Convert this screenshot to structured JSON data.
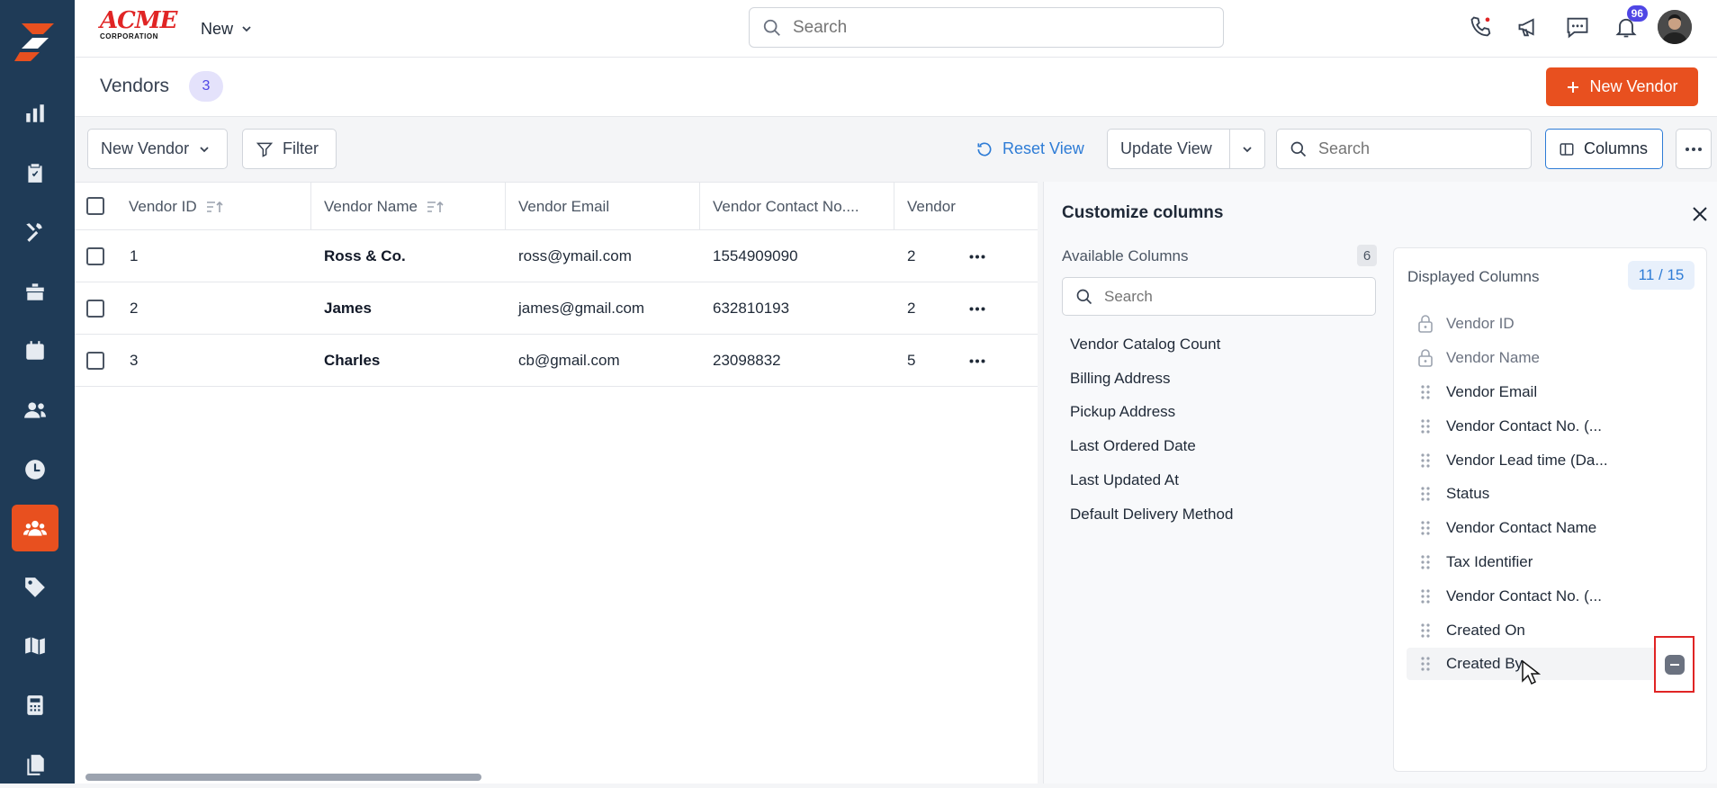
{
  "topbar": {
    "brand_top": "ACME",
    "brand_bottom": "CORPORATION",
    "new_menu_label": "New",
    "search_placeholder": "Search",
    "notification_count": "96"
  },
  "page": {
    "title": "Vendors",
    "count": "3",
    "new_button_label": "New Vendor"
  },
  "toolbar": {
    "view_select_label": "New Vendor",
    "filter_label": "Filter",
    "reset_view_label": "Reset View",
    "update_view_label": "Update View",
    "search_placeholder": "Search",
    "columns_label": "Columns"
  },
  "table": {
    "headers": [
      "Vendor ID",
      "Vendor Name",
      "Vendor Email",
      "Vendor Contact No....",
      "Vendor"
    ],
    "rows": [
      {
        "id": "1",
        "name": "Ross & Co.",
        "email": "ross@ymail.com",
        "contact": "1554909090",
        "lead": "2"
      },
      {
        "id": "2",
        "name": "James",
        "email": "james@gmail.com",
        "contact": "632810193",
        "lead": "2"
      },
      {
        "id": "3",
        "name": "Charles",
        "email": "cb@gmail.com",
        "contact": "23098832",
        "lead": "5"
      }
    ]
  },
  "panel": {
    "title": "Customize columns",
    "available_label": "Available Columns",
    "available_count": "6",
    "search_placeholder": "Search",
    "available_items": [
      "Vendor Catalog Count",
      "Billing Address",
      "Pickup Address",
      "Last Ordered Date",
      "Last Updated At",
      "Default Delivery Method"
    ],
    "displayed_label": "Displayed Columns",
    "displayed_count": "11 / 15",
    "displayed_items": [
      {
        "label": "Vendor ID",
        "locked": true
      },
      {
        "label": "Vendor Name",
        "locked": true
      },
      {
        "label": "Vendor Email",
        "locked": false
      },
      {
        "label": "Vendor Contact No. (...",
        "locked": false
      },
      {
        "label": "Vendor Lead time (Da...",
        "locked": false
      },
      {
        "label": "Status",
        "locked": false
      },
      {
        "label": "Vendor Contact Name",
        "locked": false
      },
      {
        "label": "Tax Identifier",
        "locked": false
      },
      {
        "label": "Vendor Contact No. (...",
        "locked": false
      },
      {
        "label": "Created On",
        "locked": false
      },
      {
        "label": "Created By",
        "locked": false
      }
    ]
  },
  "colors": {
    "sidebar": "#1f3b57",
    "accent": "#e8501f",
    "link": "#2e7cd6",
    "badge": "#4f46e5",
    "highlight": "#e02424"
  }
}
